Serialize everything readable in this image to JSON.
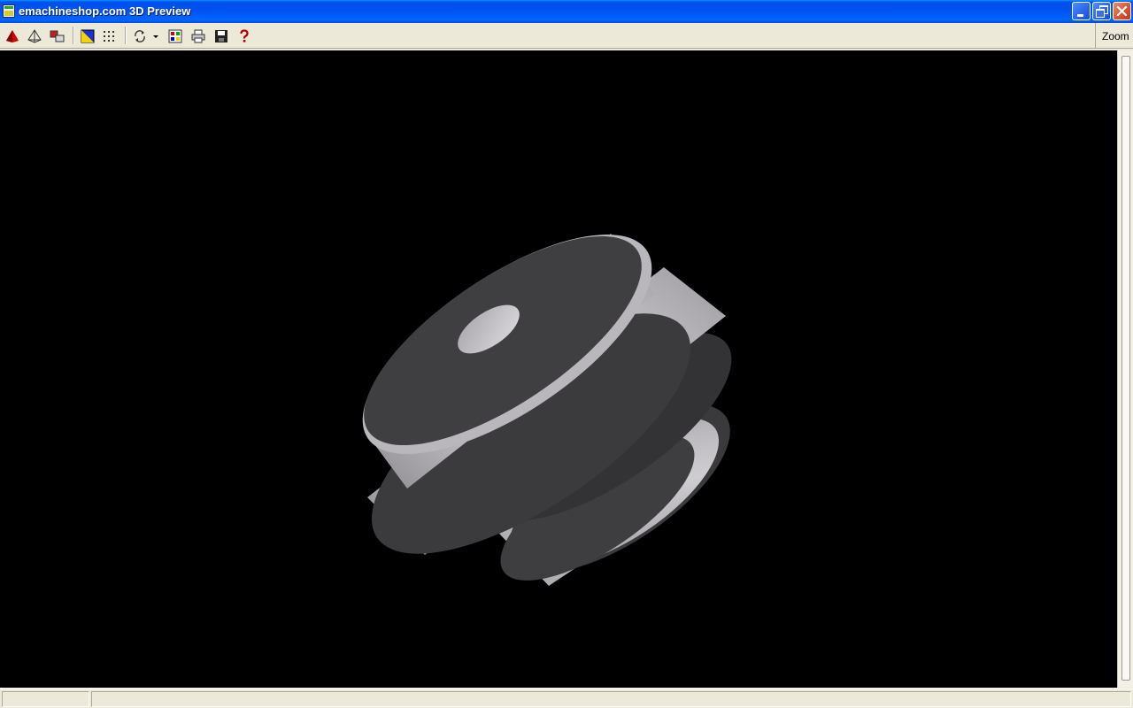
{
  "window": {
    "title": "emachineshop.com 3D Preview"
  },
  "toolbar": {
    "buttons": [
      {
        "name": "solid-view-icon"
      },
      {
        "name": "wireframe-view-icon"
      },
      {
        "name": "components-icon"
      },
      {
        "name": "color-icon"
      },
      {
        "name": "grid-icon"
      },
      {
        "name": "rotate-icon"
      },
      {
        "name": "rotate-dropdown-icon"
      },
      {
        "name": "palette-icon"
      },
      {
        "name": "print-icon"
      },
      {
        "name": "save-icon"
      },
      {
        "name": "help-icon"
      }
    ],
    "zoom_label": "Zoom"
  },
  "colors": {
    "viewport_bg": "#000000",
    "part_light": "#c8c6ca",
    "part_dark": "#3c3c3e"
  },
  "statusbar": {
    "left_text": "",
    "right_text": ""
  }
}
